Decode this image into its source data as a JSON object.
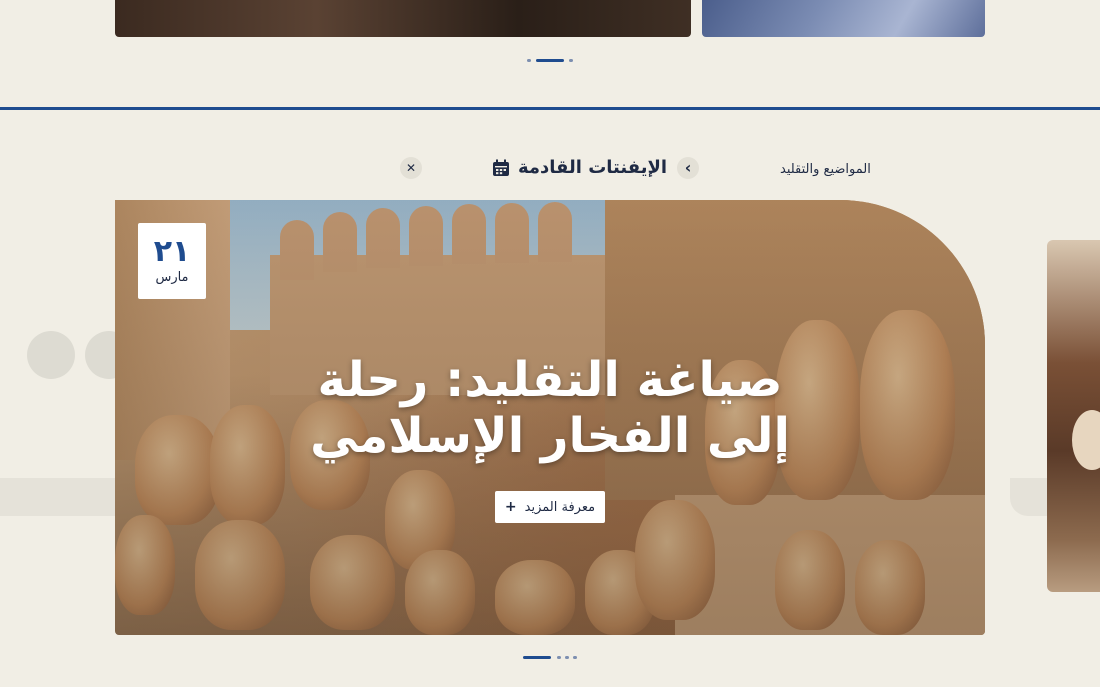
{
  "nav": {
    "topics_label": "المواضيع والتقليد",
    "title": "الإيفنتات القادمة"
  },
  "hero": {
    "date_day": "٢١",
    "date_month": "مارس",
    "title_line1": "صياغة التقليد: رحلة",
    "title_line2": "إلى الفخار الإسلامي",
    "more_label": "معرفة المزيد",
    "more_icon": "+"
  },
  "icons": {
    "chevron": "‹",
    "close": "✕"
  },
  "carousel": {
    "top_active_index": 1,
    "top_count": 3,
    "bottom_active_index": 0,
    "bottom_count": 4
  },
  "colors": {
    "background": "#f1eee5",
    "accent": "#1f4c8f",
    "text": "#1f2a44"
  }
}
